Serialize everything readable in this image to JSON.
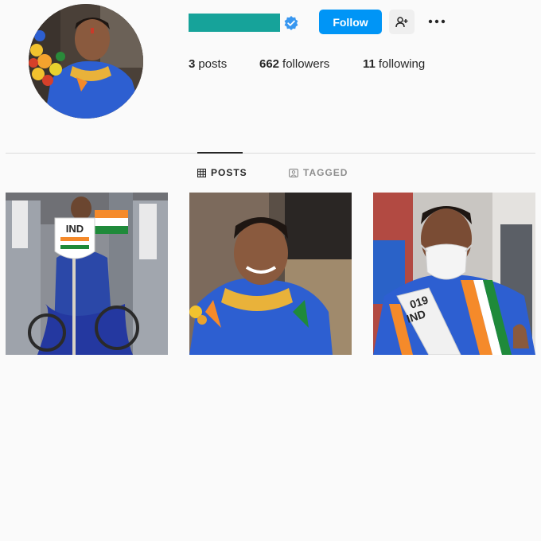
{
  "profile": {
    "follow_label": "Follow",
    "avatar_icon": "profile-photo",
    "verified_icon": "verified-badge-icon",
    "suggest_icon": "person-add-icon",
    "more_icon": "more-options-icon",
    "username_color": "#16a39a"
  },
  "stats": {
    "posts_count": "3",
    "posts_label": "posts",
    "followers_count": "662",
    "followers_label": "followers",
    "following_count": "11",
    "following_label": "following"
  },
  "tabs": [
    {
      "label": "POSTS",
      "icon": "grid-icon",
      "active": true
    },
    {
      "label": "TAGGED",
      "icon": "tag-icon",
      "active": false
    }
  ],
  "posts": [
    {
      "sign_text": "IND",
      "image": "athlete-in-wheelchair-with-flag"
    },
    {
      "image": "athlete-smiling-portrait"
    },
    {
      "sash_text": "019\nIND",
      "image": "athlete-with-mask-and-sash"
    }
  ],
  "colors": {
    "accent": "#0095f6",
    "background": "#fafafa",
    "jersey_blue": "#2d5fd1",
    "saffron": "#f58a2a",
    "green": "#1f8a3a"
  }
}
